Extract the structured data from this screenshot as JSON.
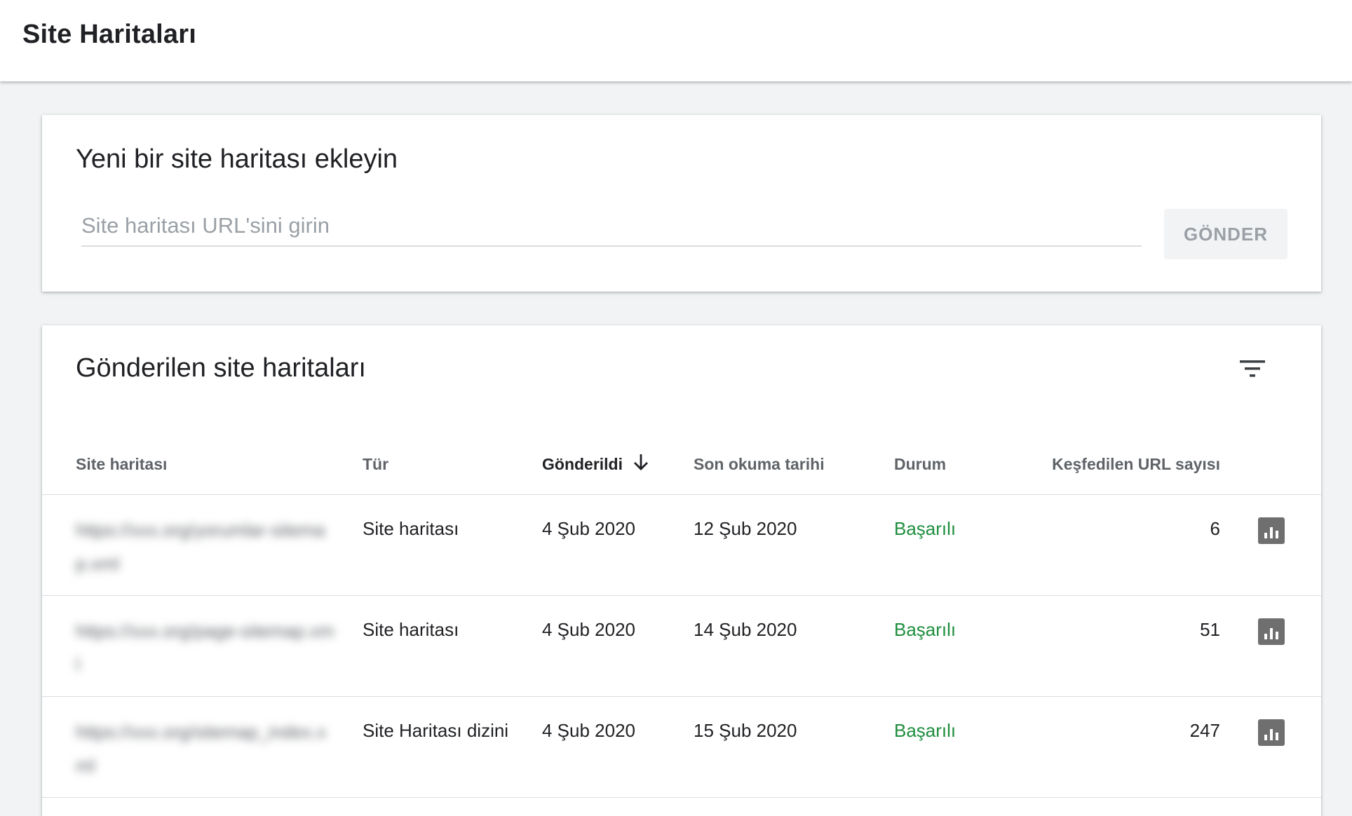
{
  "page": {
    "title": "Site Haritaları"
  },
  "add_card": {
    "title": "Yeni bir site haritası ekleyin",
    "input_placeholder": "Site haritası URL'sini girin",
    "input_value": "",
    "submit_label": "GÖNDER"
  },
  "list_card": {
    "title": "Gönderilen site haritaları",
    "filter_icon": "filter-list-icon",
    "columns": {
      "sitemap": "Site haritası",
      "type": "Tür",
      "submitted": "Gönderildi",
      "last_read": "Son okuma tarihi",
      "status": "Durum",
      "discovered": "Keşfedilen URL sayısı"
    },
    "sort": {
      "column": "submitted",
      "direction": "desc",
      "icon": "arrow-down-icon"
    },
    "rows": [
      {
        "url": "https://xxx.org/yorumlar-sitemap.xml",
        "type": "Site haritası",
        "submitted": "4 Şub 2020",
        "last_read": "12 Şub 2020",
        "status": "Başarılı",
        "discovered": "6"
      },
      {
        "url": "https://xxx.org/page-sitemap.xml",
        "type": "Site haritası",
        "submitted": "4 Şub 2020",
        "last_read": "14 Şub 2020",
        "status": "Başarılı",
        "discovered": "51"
      },
      {
        "url": "https://xxx.org/sitemap_index.xml",
        "type": "Site Haritası dizini",
        "submitted": "4 Şub 2020",
        "last_read": "15 Şub 2020",
        "status": "Başarılı",
        "discovered": "247"
      }
    ],
    "row_action_icon": "bar-chart-icon"
  },
  "colors": {
    "status_success": "#1e8e3e",
    "header_text": "#5f6368",
    "icon_bg": "#6f6f6f"
  }
}
